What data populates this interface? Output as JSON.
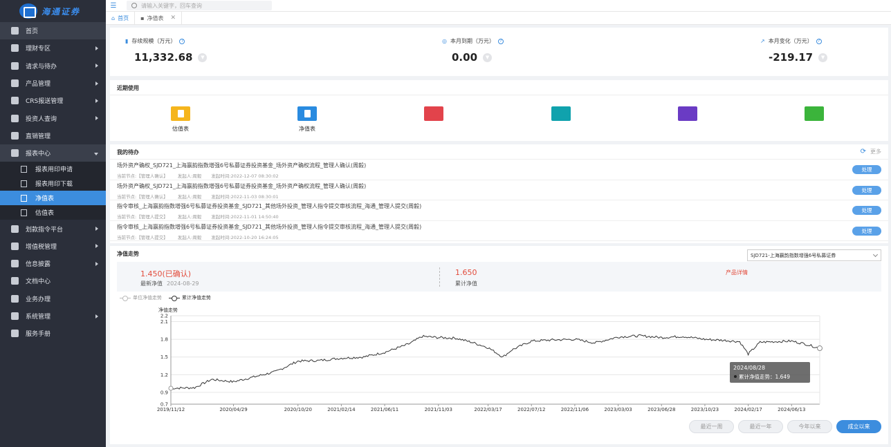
{
  "app": {
    "logo_text": "海通证券"
  },
  "topbar": {
    "search_placeholder": "请输入关键字，回车查询"
  },
  "tabs": [
    {
      "label": "首页"
    },
    {
      "label": "净值表"
    }
  ],
  "sidebar": {
    "items": [
      {
        "label": "首页"
      },
      {
        "label": "理财专区"
      },
      {
        "label": "请求与待办"
      },
      {
        "label": "产品管理"
      },
      {
        "label": "CRS报送管理"
      },
      {
        "label": "投资人查询"
      },
      {
        "label": "直销管理"
      },
      {
        "label": "报表中心"
      },
      {
        "label": "划款指令平台"
      },
      {
        "label": "增值税管理"
      },
      {
        "label": "信息披露"
      },
      {
        "label": "文档中心"
      },
      {
        "label": "业务办理"
      },
      {
        "label": "系统管理"
      },
      {
        "label": "服务手册"
      }
    ],
    "report_sub": [
      {
        "label": "报表用印申请"
      },
      {
        "label": "报表用印下载"
      },
      {
        "label": "净值表"
      },
      {
        "label": "估值表"
      }
    ]
  },
  "kpi": {
    "scale_label": "存续规模（万元）",
    "scale_value": "11,332.68",
    "due_label": "本月到期（万元）",
    "due_value": "0.00",
    "change_label": "本月变化（万元）",
    "change_value": "-219.17"
  },
  "recent": {
    "title": "近期使用",
    "items": [
      {
        "label": "估值表",
        "color": "#f5b51d"
      },
      {
        "label": "净值表",
        "color": "#2a8be0"
      },
      {
        "label": "",
        "color": "#e2434b"
      },
      {
        "label": "",
        "color": "#10a2ad"
      },
      {
        "label": "",
        "color": "#6a3bc4"
      },
      {
        "label": "",
        "color": "#3bb43b"
      }
    ]
  },
  "todo": {
    "title": "我的待办",
    "more": "更多",
    "button_label": "处理",
    "rows": [
      {
        "title": "场外资产确权_SJD721_上海嬴韵指数增强6号私募证券投资基金_场外资产确权流程_管理人确认(周毅)",
        "node": "当前节点:【管理人确认】",
        "initiator": "发起人:周毅",
        "time": "发起时间:2022-12-07 08:30:02"
      },
      {
        "title": "场外资产确权_SJD721_上海嬴韵指数增强6号私募证券投资基金_场外资产确权流程_管理人确认(周毅)",
        "node": "当前节点:【管理人确认】",
        "initiator": "发起人:周毅",
        "time": "发起时间:2022-11-03 08:30:01"
      },
      {
        "title": "指令审核_上海嬴韵指数增强6号私募证券投资基金_SJD721_其他场外投资_管理人指令提交审核流程_海通_管理人提交(周毅)",
        "node": "当前节点:【管理人提交】",
        "initiator": "发起人:周毅",
        "time": "发起时间:2022-11-01 14:50:40"
      },
      {
        "title": "指令审核_上海嬴韵指数增强6号私募证券投资基金_SJD721_其他场外投资_管理人指令提交审核流程_海通_管理人提交(周毅)",
        "node": "当前节点:【管理人提交】",
        "initiator": "发起人:周毅",
        "time": "发起时间:2022-10-20 16:24:05"
      }
    ]
  },
  "trend": {
    "title": "净值走势",
    "fund_select": "SJD721-上海嬴韵指数增强6号私募证券",
    "latest_value": "1.450(已确认)",
    "latest_label": "最新净值",
    "latest_date": "2024-08-29",
    "cum_value": "1.650",
    "cum_label": "累计净值",
    "detail_link": "产品详情",
    "legend": [
      {
        "label": "单位净值走势",
        "active": false
      },
      {
        "label": "累计净值走势",
        "active": true
      }
    ],
    "tooltip_date": "2024/08/28",
    "tooltip_value": "累计净值走势：1.649",
    "range_buttons": [
      {
        "label": "最近一周",
        "active": false
      },
      {
        "label": "最近一年",
        "active": false
      },
      {
        "label": "今年以来",
        "active": false
      },
      {
        "label": "成立以来",
        "active": true
      }
    ]
  },
  "chart_data": {
    "type": "line",
    "ylabel": "净值走势",
    "yticks": [
      0.7,
      0.9,
      1.2,
      1.5,
      1.8,
      2.1,
      2.2
    ],
    "ylim": [
      0.7,
      2.2
    ],
    "xticks": [
      "2019/11/12",
      "2020/04/29",
      "2020/10/20",
      "2021/02/14",
      "2021/06/11",
      "2021/11/03",
      "2022/03/17",
      "2022/07/12",
      "2022/11/06",
      "2023/03/03",
      "2023/06/28",
      "2023/10/23",
      "2024/02/17",
      "2024/06/13"
    ],
    "series": [
      {
        "name": "累计净值走势",
        "x": [
          "2019/11/12",
          "2020/01/15",
          "2020/03/01",
          "2020/04/29",
          "2020/06/15",
          "2020/08/20",
          "2020/10/20",
          "2020/12/15",
          "2021/02/14",
          "2021/04/15",
          "2021/06/11",
          "2021/08/15",
          "2021/09/20",
          "2021/11/03",
          "2021/12/20",
          "2022/02/01",
          "2022/03/17",
          "2022/04/26",
          "2022/05/20",
          "2022/07/12",
          "2022/09/10",
          "2022/11/06",
          "2022/12/30",
          "2023/03/03",
          "2023/04/30",
          "2023/06/28",
          "2023/08/25",
          "2023/10/23",
          "2023/12/20",
          "2024/01/25",
          "2024/02/17",
          "2024/03/20",
          "2024/04/25",
          "2024/06/13",
          "2024/07/20",
          "2024/08/28"
        ],
        "y": [
          0.97,
          0.98,
          1.12,
          1.08,
          1.15,
          1.25,
          1.43,
          1.44,
          1.48,
          1.5,
          1.58,
          1.72,
          1.85,
          1.83,
          1.82,
          1.75,
          1.66,
          1.5,
          1.62,
          1.77,
          1.79,
          1.8,
          1.74,
          1.84,
          1.86,
          1.83,
          1.85,
          1.8,
          1.78,
          1.76,
          1.55,
          1.75,
          1.76,
          1.77,
          1.72,
          1.649
        ]
      }
    ]
  },
  "colors": {
    "accent": "#3c8dde",
    "sidebar_bg": "#2b2f3a",
    "red": "#e24b3b"
  }
}
